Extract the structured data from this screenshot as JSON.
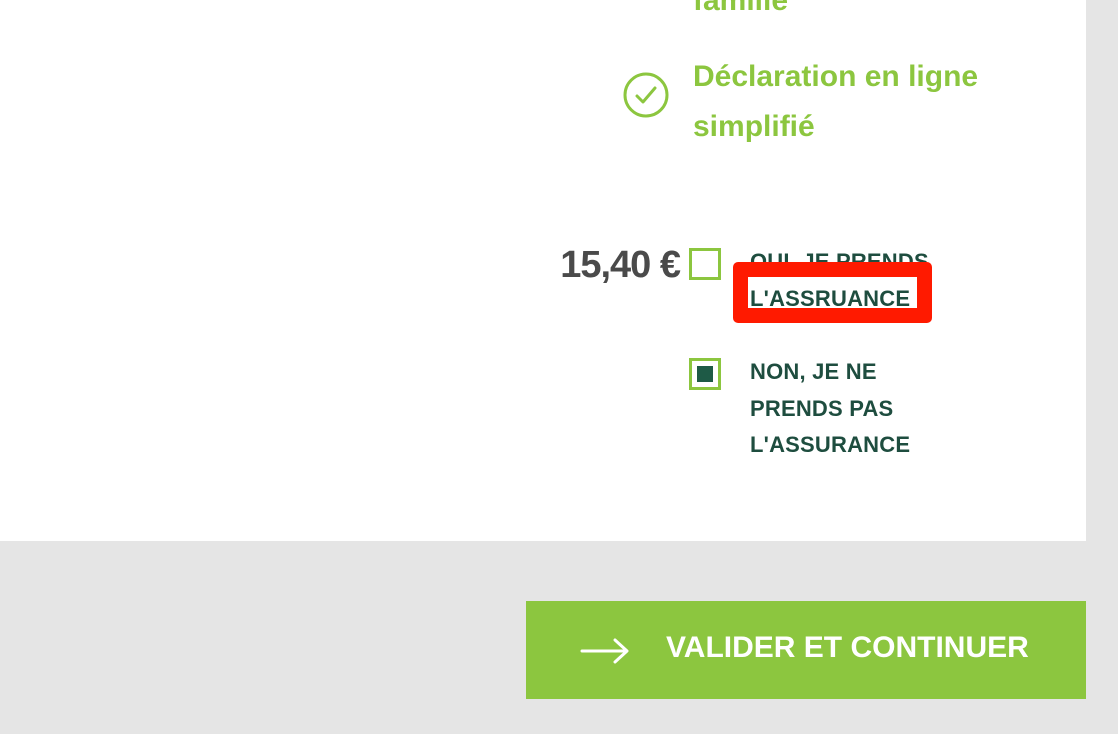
{
  "features": {
    "partial_label": "famille",
    "items": [
      {
        "label": "Déclaration en ligne simplifié",
        "icon": "check-circle-icon"
      }
    ]
  },
  "insurance": {
    "price": "15,40 €",
    "options": [
      {
        "label": "OUI, JE PRENDS L'ASSRUANCE",
        "checked": false
      },
      {
        "label": "NON, JE NE PRENDS PAS L'ASSURANCE",
        "checked": true
      }
    ]
  },
  "cta": {
    "label": "VALIDER ET CONTINUER",
    "icon": "arrow-right-icon"
  },
  "colors": {
    "accent_green": "#8cc63f",
    "dark_green": "#1e4d3f",
    "highlight_red": "#ff1a00",
    "price_gray": "#4a4a4a",
    "page_background": "#e5e5e5",
    "card_background": "#ffffff"
  }
}
